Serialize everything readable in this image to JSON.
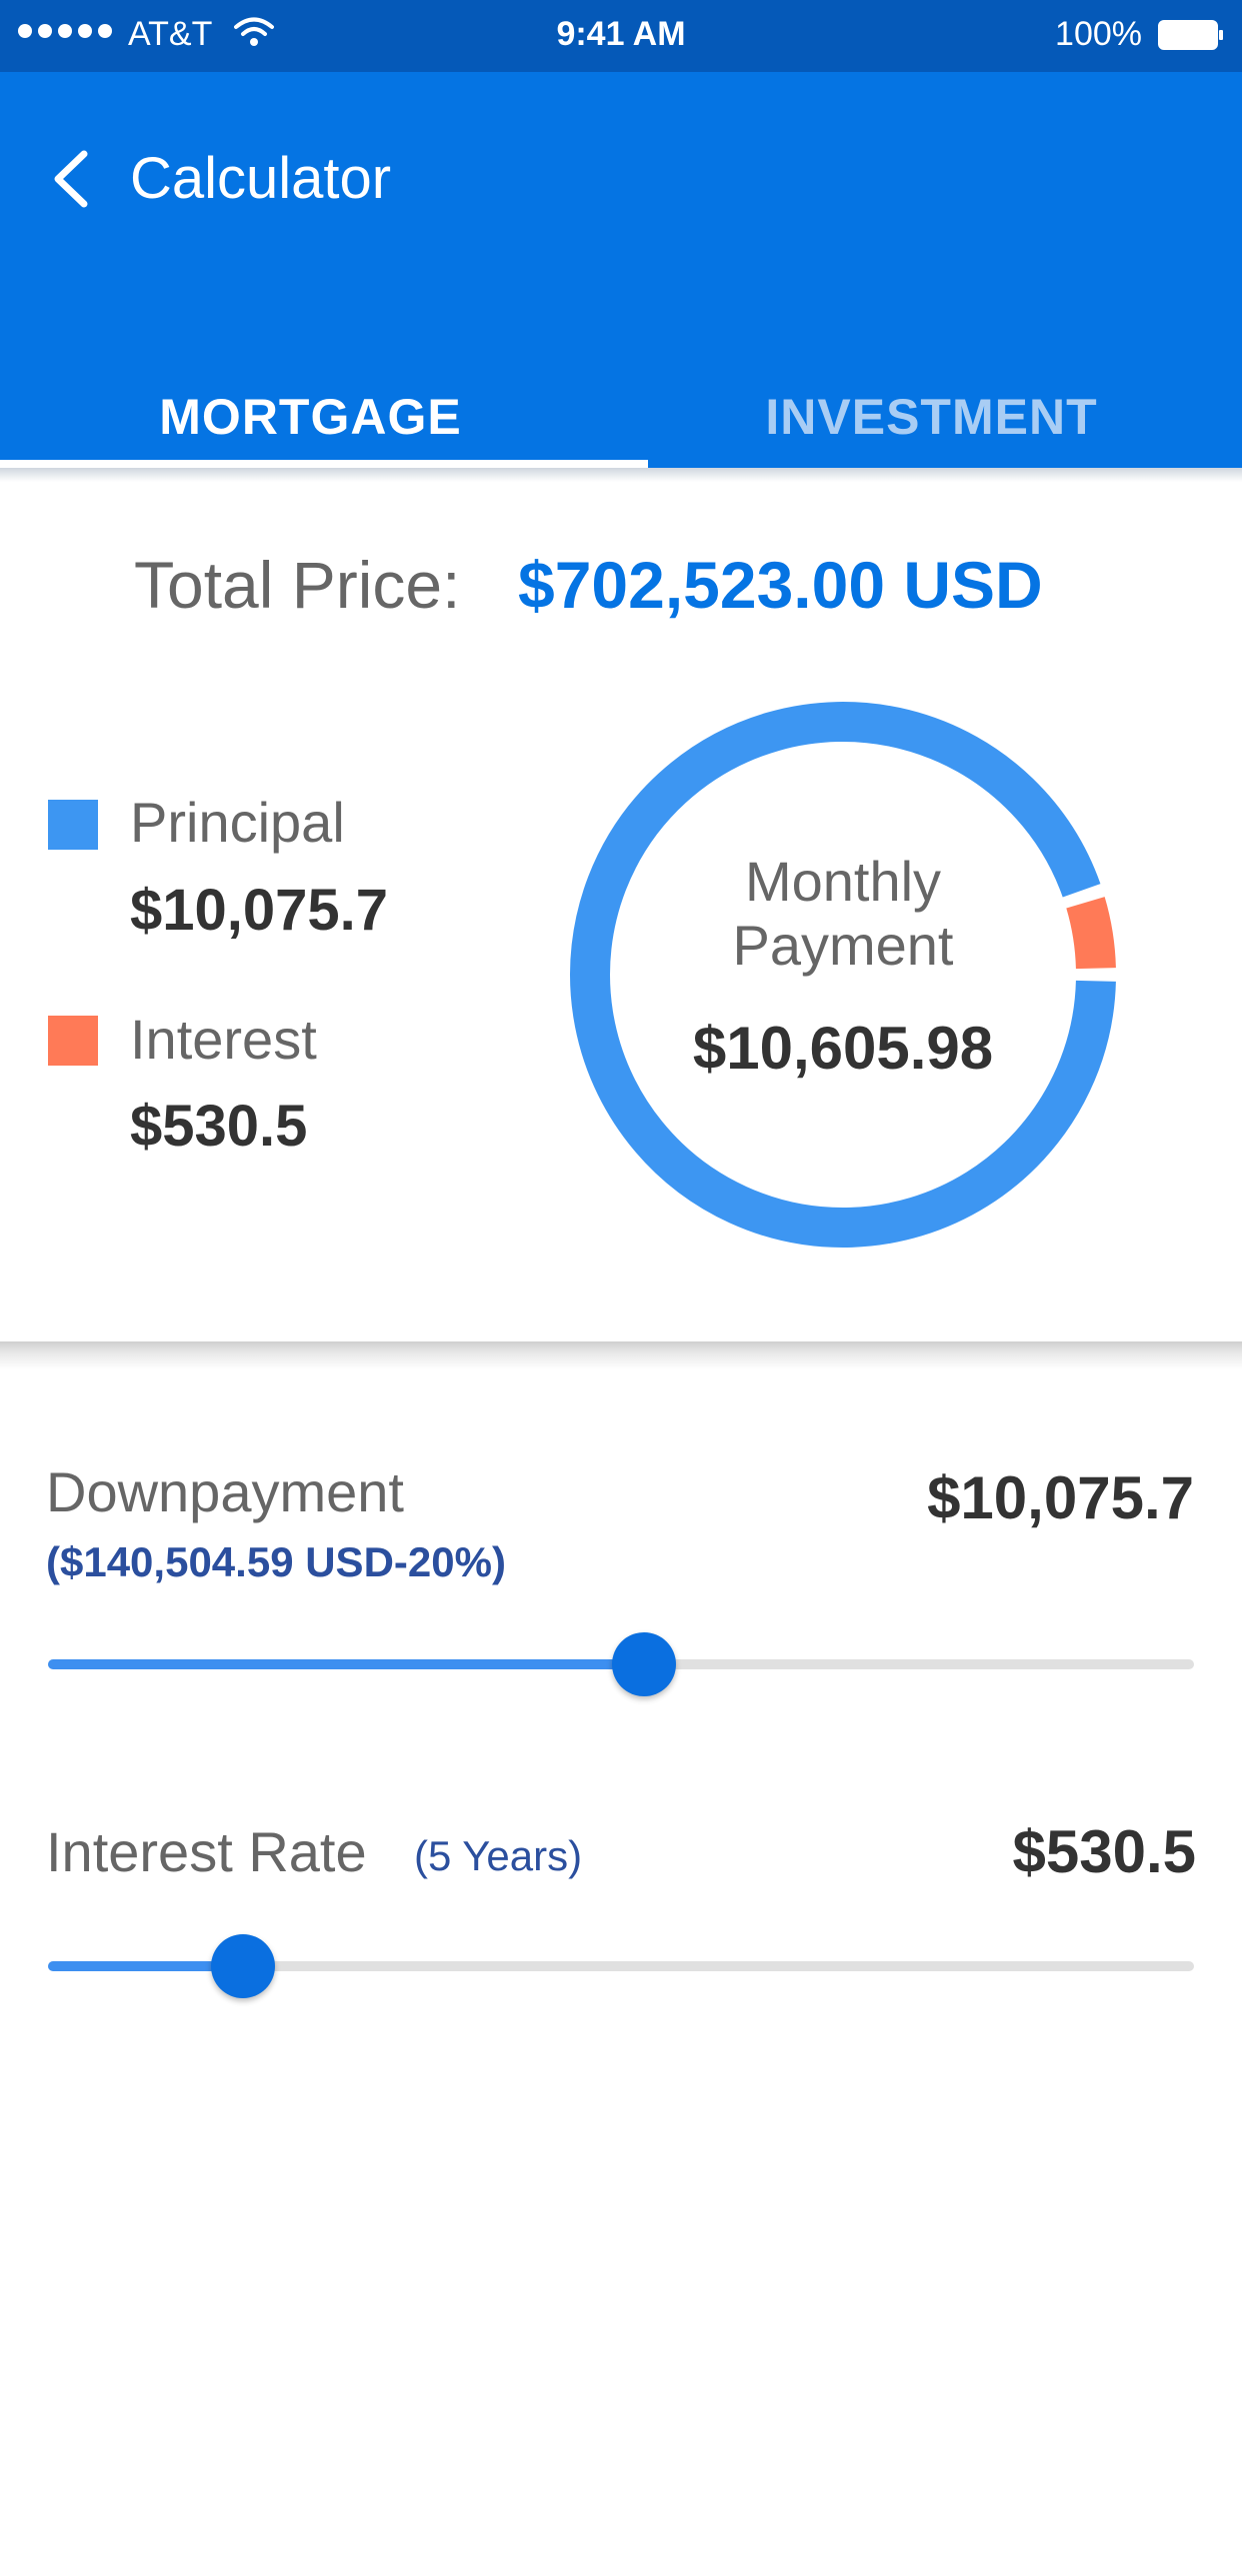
{
  "status_bar": {
    "carrier": "AT&T",
    "time": "9:41 AM",
    "battery": "100%",
    "icons": [
      "signal-dots-icon",
      "wifi-icon",
      "battery-icon"
    ]
  },
  "header": {
    "title": "Calculator",
    "back_icon": "chevron-left-icon",
    "background_color": "#0574e3",
    "tabs": [
      {
        "label": "MORTGAGE",
        "active": true
      },
      {
        "label": "INVESTMENT",
        "active": false
      }
    ]
  },
  "summary": {
    "total_price_label": "Total Price:",
    "total_price_value": "$702,523.00 USD",
    "legend": [
      {
        "label": "Principal",
        "value": "$10,075.7",
        "color": "#3d96f2"
      },
      {
        "label": "Interest",
        "value": "$530.5",
        "color": "#ff7a57"
      }
    ],
    "donut": {
      "line1": "Monthly",
      "line2": "Payment",
      "value": "$10,605.98",
      "shares": [
        10075.7,
        530.5
      ]
    }
  },
  "sliders": {
    "downpayment": {
      "title": "Downpayment",
      "subtitle": "($140,504.59 USD-20%)",
      "value": "$10,075.7",
      "level": 0.52
    },
    "interest_rate": {
      "title": "Interest Rate",
      "subtitle": "(5 Years)",
      "value": "$530.5",
      "level": 0.17
    }
  }
}
